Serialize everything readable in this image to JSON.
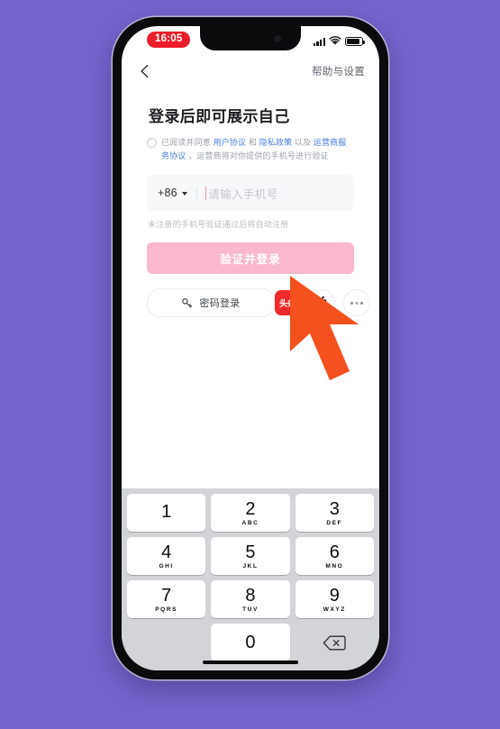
{
  "background_color": "#7464cc",
  "status_bar": {
    "time": "16:05",
    "time_badge_color": "#ec1c2a",
    "signal_icon": "signal-bars-icon",
    "wifi_icon": "wifi-icon",
    "battery_icon": "battery-icon"
  },
  "nav": {
    "back_icon": "back-chevron-icon",
    "help_label": "帮助与设置"
  },
  "main": {
    "title": "登录后即可展示自己",
    "agreement": {
      "radio_checked": false,
      "prefix": "已阅读并同意 ",
      "link1": "用户协议",
      "mid1": " 和 ",
      "link2": "隐私政策",
      "mid2": " 以及 ",
      "link3": "运营商服务协议",
      "suffix": " ，运营商将对你提供的手机号进行验证",
      "link_color": "#4a7fe0"
    },
    "phone_input": {
      "country_code": "+86",
      "caret_icon": "chevron-down-icon",
      "placeholder": "请输入手机号",
      "value": "",
      "cursor_color": "#f090ab"
    },
    "hint": "未注册的手机号验证通过后将自动注册",
    "cta_label": "验证并登录",
    "cta_color": "#f9b8cc",
    "password_login": {
      "icon": "key-icon",
      "label": "密码登录"
    },
    "socials": [
      {
        "name": "toutiao-login-icon",
        "label": "头条",
        "color": "#ef2b2b"
      },
      {
        "name": "apple-login-icon",
        "label": "",
        "color": "#0b0b0d"
      },
      {
        "name": "more-login-options-icon",
        "label": "",
        "color": "#8b9099"
      }
    ]
  },
  "keyboard": {
    "rows": [
      [
        {
          "num": "1",
          "sub": ""
        },
        {
          "num": "2",
          "sub": "ABC"
        },
        {
          "num": "3",
          "sub": "DEF"
        }
      ],
      [
        {
          "num": "4",
          "sub": "GHI"
        },
        {
          "num": "5",
          "sub": "JKL"
        },
        {
          "num": "6",
          "sub": "MNO"
        }
      ],
      [
        {
          "num": "7",
          "sub": "PQRS"
        },
        {
          "num": "8",
          "sub": "TUV"
        },
        {
          "num": "9",
          "sub": "WXYZ"
        }
      ],
      [
        {
          "num": "",
          "sub": ""
        },
        {
          "num": "0",
          "sub": ""
        },
        {
          "num": "delete-key-icon",
          "sub": ""
        }
      ]
    ]
  },
  "cursor": {
    "icon": "mouse-pointer-arrow",
    "color": "#f4511e"
  }
}
